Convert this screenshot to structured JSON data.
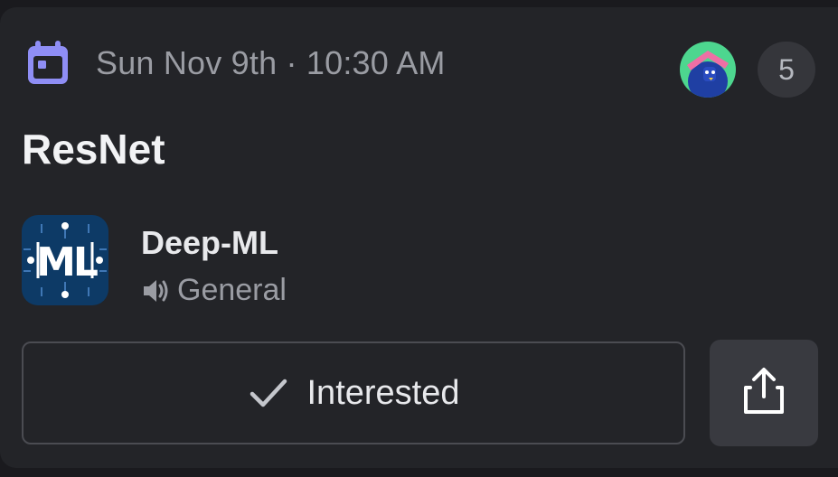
{
  "event": {
    "date_time": "Sun Nov 9th · 10:30 AM",
    "title": "ResNet",
    "interested_count": "5"
  },
  "server": {
    "name": "Deep-ML",
    "icon_text": "ML",
    "channel": "General",
    "channel_type": "voice"
  },
  "actions": {
    "interested_label": "Interested",
    "share_icon": "share-icon"
  },
  "icons": {
    "date": "calendar-icon",
    "channel": "speaker-icon",
    "interested": "check-icon"
  },
  "colors": {
    "card_bg": "#232428",
    "calendar_accent": "#8f8ef5",
    "text_primary": "#f2f3f5",
    "text_muted": "#9a9ca3",
    "button_border": "#4b4c52",
    "share_bg": "#393a40",
    "badge_bg": "#35363b"
  }
}
